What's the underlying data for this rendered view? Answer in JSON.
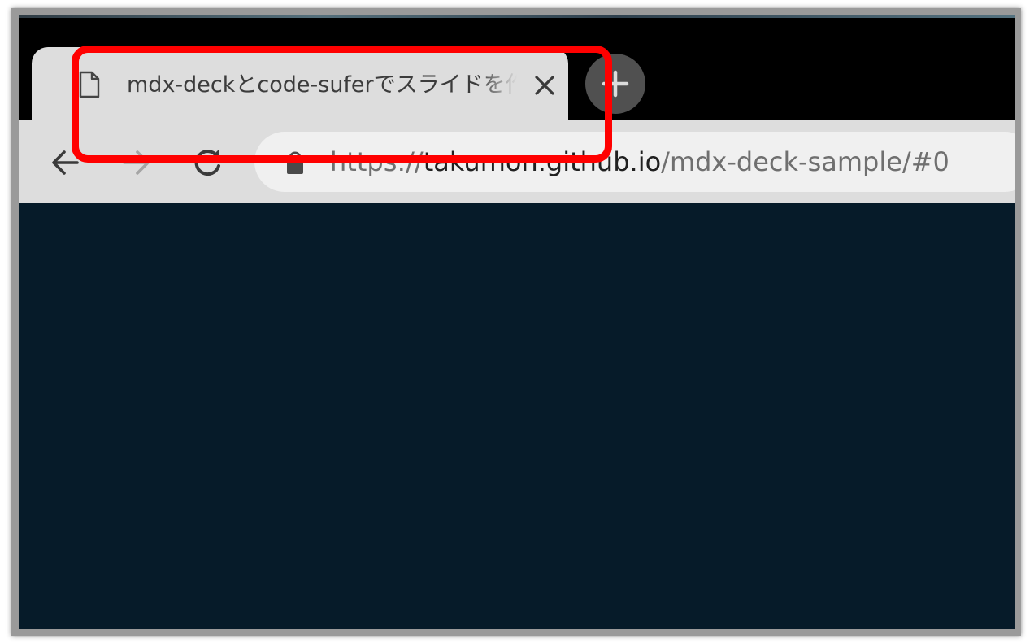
{
  "tab": {
    "title": "mdx-deckとcode-suferでスライドを作",
    "favicon": "document-icon",
    "close_icon": "close-icon"
  },
  "newtab": {
    "icon": "plus-icon"
  },
  "toolbar": {
    "back_icon": "arrow-left-icon",
    "forward_icon": "arrow-right-icon",
    "reload_icon": "reload-icon"
  },
  "omnibox": {
    "security_icon": "lock-icon",
    "url_scheme": "https://",
    "url_host": "takumon.github.io",
    "url_path": "/mdx-deck-sample/#0"
  },
  "annotation": {
    "highlight_color": "#ff0000"
  },
  "colors": {
    "tab_bg": "#dddddd",
    "tabstrip_bg": "#000000",
    "content_bg": "#061b29",
    "newtab_bg": "#505050"
  }
}
